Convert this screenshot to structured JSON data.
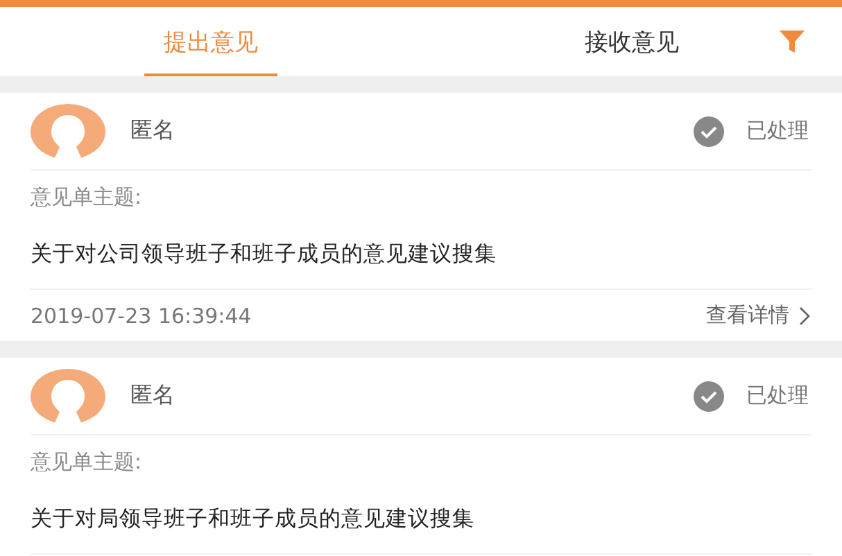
{
  "tabs": [
    {
      "label": "提出意见",
      "selected": true
    },
    {
      "label": "接收意见",
      "selected": false
    }
  ],
  "cards": [
    {
      "name": "匿名",
      "processed": true,
      "status": "已处理",
      "subject_label": "意见单主题:",
      "subject": "关于对公司领导班子和班子成员的意见建议搜集",
      "time": "2019-07-23 16:39:44",
      "detail_link": "查看详情"
    },
    {
      "name": "匿名",
      "processed": true,
      "status": "已处理",
      "subject_label": "意见单主题:",
      "subject": "关于对局领导班子和班子成员的意见建议搜集"
    }
  ]
}
